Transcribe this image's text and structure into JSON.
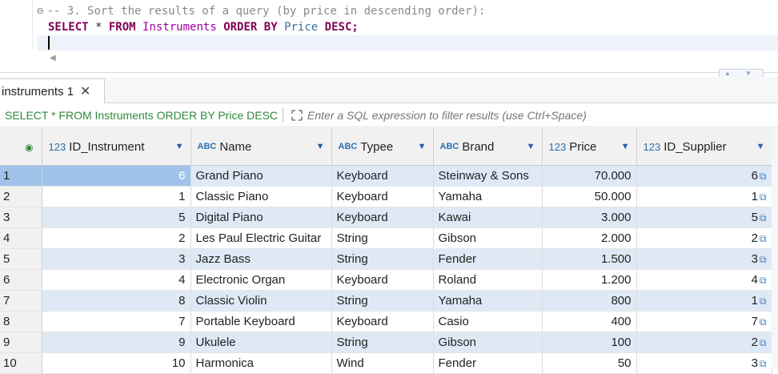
{
  "editor": {
    "comment": "-- 3. Sort the results of a query (by price in descending order):",
    "sql_tokens": [
      {
        "t": "SELECT",
        "c": "kw"
      },
      {
        "t": " * ",
        "c": ""
      },
      {
        "t": "FROM",
        "c": "kw"
      },
      {
        "t": " ",
        "c": ""
      },
      {
        "t": "Instruments",
        "c": "tbl"
      },
      {
        "t": " ",
        "c": ""
      },
      {
        "t": "ORDER BY",
        "c": "kw"
      },
      {
        "t": " ",
        "c": ""
      },
      {
        "t": "Price",
        "c": "col"
      },
      {
        "t": " ",
        "c": ""
      },
      {
        "t": "DESC",
        "c": "kw"
      },
      {
        "t": ";",
        "c": "kw"
      }
    ]
  },
  "tab": {
    "label": "instruments 1",
    "close": "✕"
  },
  "filter": {
    "query": "SELECT * FROM Instruments ORDER BY Price DESC",
    "placeholder": "Enter a SQL expression to filter results (use Ctrl+Space)"
  },
  "grid": {
    "columns": [
      {
        "type": "123",
        "label": "ID_Instrument",
        "num": true
      },
      {
        "type": "ABC",
        "label": "Name",
        "num": false
      },
      {
        "type": "ABC",
        "label": "Typee",
        "num": false
      },
      {
        "type": "ABC",
        "label": "Brand",
        "num": false
      },
      {
        "type": "123",
        "label": "Price",
        "num": true
      },
      {
        "type": "123",
        "label": "ID_Supplier",
        "num": true
      }
    ],
    "rows": [
      [
        "1",
        "6",
        "Grand Piano",
        "Keyboard",
        "Steinway & Sons",
        "70.000",
        "6"
      ],
      [
        "2",
        "1",
        "Classic Piano",
        "Keyboard",
        "Yamaha",
        "50.000",
        "1"
      ],
      [
        "3",
        "5",
        "Digital Piano",
        "Keyboard",
        "Kawai",
        "3.000",
        "5"
      ],
      [
        "4",
        "2",
        "Les Paul Electric Guitar",
        "String",
        "Gibson",
        "2.000",
        "2"
      ],
      [
        "5",
        "3",
        "Jazz Bass",
        "String",
        "Fender",
        "1.500",
        "3"
      ],
      [
        "6",
        "4",
        "Electronic Organ",
        "Keyboard",
        "Roland",
        "1.200",
        "4"
      ],
      [
        "7",
        "8",
        "Classic Violin",
        "String",
        "Yamaha",
        "800",
        "1"
      ],
      [
        "8",
        "7",
        "Portable Keyboard",
        "Keyboard",
        "Casio",
        "400",
        "7"
      ],
      [
        "9",
        "9",
        "Ukulele",
        "String",
        "Gibson",
        "100",
        "2"
      ],
      [
        "10",
        "10",
        "Harmonica",
        "Wind",
        "Fender",
        "50",
        "3"
      ]
    ],
    "selected_row": 0
  },
  "colors": {
    "keyword": "#7f0055",
    "table": "#a000a0",
    "column": "#3c6e9e",
    "filter_query": "#2e8b3a",
    "row_alt": "#dfe9f6",
    "selected": "#9fc3ea"
  }
}
